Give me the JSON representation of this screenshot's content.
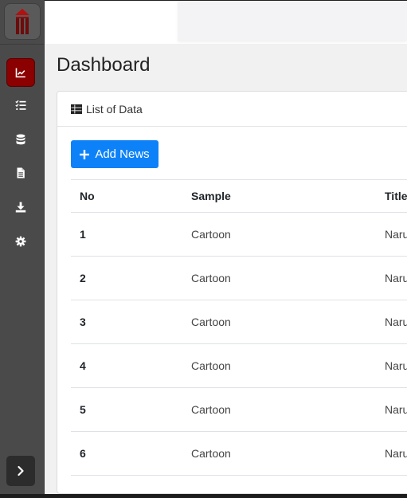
{
  "page": {
    "title": "Dashboard"
  },
  "sidebar": {
    "logo_icon": "pencils-logo-icon",
    "items": [
      {
        "id": "dashboard",
        "icon": "chart-line-icon",
        "active": true
      },
      {
        "id": "tasks",
        "icon": "tasks-icon",
        "active": false
      },
      {
        "id": "database",
        "icon": "database-icon",
        "active": false
      },
      {
        "id": "documents",
        "icon": "file-icon",
        "active": false
      },
      {
        "id": "download",
        "icon": "download-icon",
        "active": false
      },
      {
        "id": "settings",
        "icon": "gear-icon",
        "active": false
      }
    ],
    "collapse_icon": "chevron-right-icon"
  },
  "card": {
    "header_label": "List of Data",
    "add_button_label": "Add News"
  },
  "table": {
    "columns": [
      "No",
      "Sample",
      "Title"
    ],
    "rows": [
      {
        "no": "1",
        "sample": "Cartoon",
        "title": "Naru"
      },
      {
        "no": "2",
        "sample": "Cartoon",
        "title": "Naru"
      },
      {
        "no": "3",
        "sample": "Cartoon",
        "title": "Naru"
      },
      {
        "no": "4",
        "sample": "Cartoon",
        "title": "Naru"
      },
      {
        "no": "5",
        "sample": "Cartoon",
        "title": "Naru"
      },
      {
        "no": "6",
        "sample": "Cartoon",
        "title": "Naru"
      }
    ]
  },
  "colors": {
    "sidebar": "#4a4a4a",
    "active_item": "#8b0000",
    "primary_button": "#0d82f8"
  }
}
